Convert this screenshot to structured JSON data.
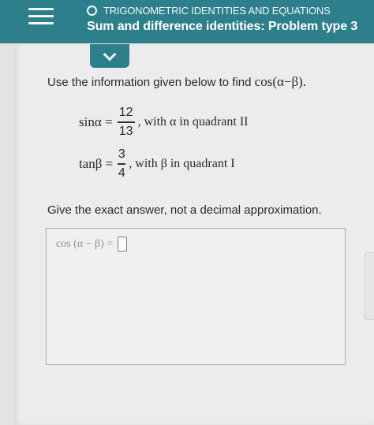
{
  "header": {
    "topic": "TRIGONOMETRIC IDENTITIES AND EQUATIONS",
    "title": "Sum and difference identities: Problem type 3"
  },
  "problem": {
    "instruction": "Use the information given below to find",
    "target": "cos(α−β).",
    "given": [
      {
        "lhs": "sinα =",
        "numerator": "12",
        "denominator": "13",
        "condition": ", with α in quadrant II"
      },
      {
        "lhs": "tanβ =",
        "numerator": "3",
        "denominator": "4",
        "condition": ", with β in quadrant I"
      }
    ],
    "note": "Give the exact answer, not a decimal approximation."
  },
  "answer": {
    "expression": "cos (α − β) =",
    "value": ""
  },
  "colors": {
    "header_bg": "#2c7f8b",
    "page_bg": "#ececec"
  }
}
